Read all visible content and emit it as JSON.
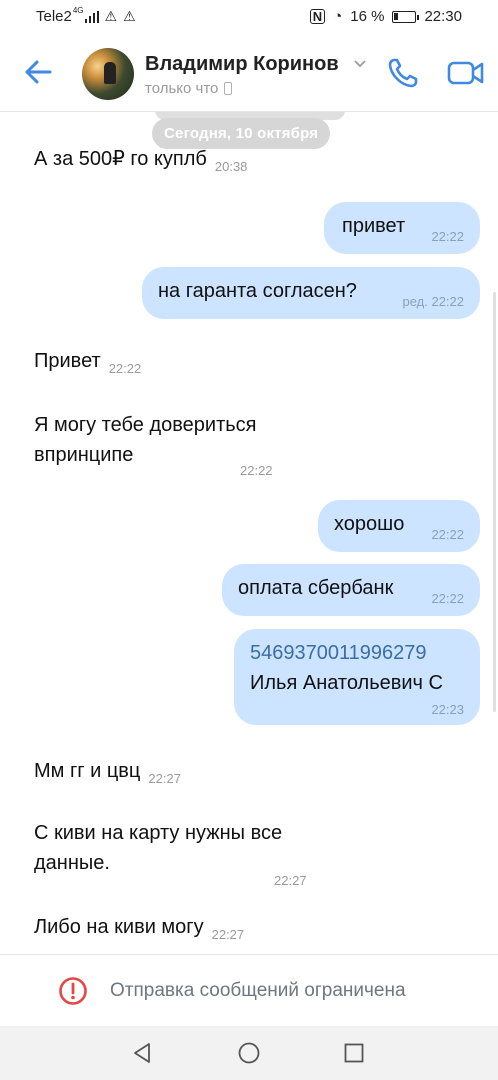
{
  "status_bar": {
    "carrier": "Tele2",
    "network": "4G",
    "battery_percent": "16 %",
    "time": "22:30"
  },
  "header": {
    "contact_name": "Владимир Коринов",
    "presence": "только что"
  },
  "chat": {
    "date_separator": "Сегодня, 10 октября",
    "messages": [
      {
        "direction": "in",
        "text": "А за 500₽ го куплб",
        "time": "20:38"
      },
      {
        "direction": "out",
        "text": "привет",
        "time": "22:22"
      },
      {
        "direction": "out",
        "text": "на гаранта согласен?",
        "time": "ред. 22:22"
      },
      {
        "direction": "in",
        "text": "Привет",
        "time": "22:22"
      },
      {
        "direction": "in",
        "text_line1": "Я могу тебе довериться",
        "text_line2": "впринципе",
        "time": "22:22"
      },
      {
        "direction": "out",
        "text": "хорошо",
        "time": "22:22"
      },
      {
        "direction": "out",
        "text": "оплата сбербанк",
        "time": "22:22"
      },
      {
        "direction": "out",
        "link": "5469370011996279",
        "text": "Илья Анатольевич С",
        "time": "22:23"
      },
      {
        "direction": "in",
        "text": "Мм гг и цвц",
        "time": "22:27"
      },
      {
        "direction": "in",
        "text_line1": "С киви на карту нужны все",
        "text_line2": "данные.",
        "time": "22:27"
      },
      {
        "direction": "in",
        "text": "Либо на киви могу",
        "time": "22:27"
      }
    ]
  },
  "footer": {
    "notice": "Отправка сообщений ограничена"
  },
  "colors": {
    "accent": "#3f8ae0",
    "bubble_out": "#cce4ff",
    "error": "#e64646",
    "link": "#2a5885"
  }
}
